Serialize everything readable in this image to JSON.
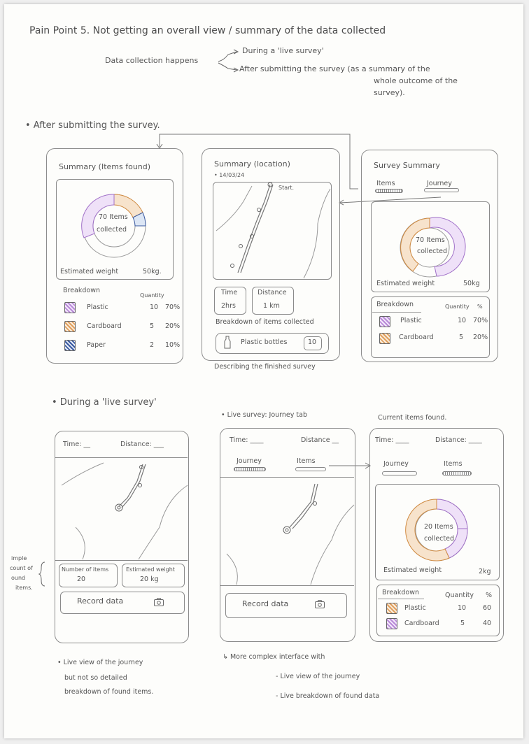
{
  "title": "Pain Point 5. Not getting an overall view / summary of the data collected",
  "intro": {
    "label": "Data collection happens",
    "branch1": "During a 'live survey'",
    "branch2_line1": "After submitting the survey (as a summary of the",
    "branch2_line2": "whole outcome of the",
    "branch2_line3": "survey)."
  },
  "section1": {
    "heading": "• After submitting the survey."
  },
  "screen1": {
    "title": "Summary (Items found)",
    "donut_line1": "70 Items",
    "donut_line2": "collected",
    "est_label": "Estimated weight",
    "est_value": "50kg.",
    "breakdown": "Breakdown",
    "quantity": "Quantity",
    "rows": [
      {
        "name": "Plastic",
        "qty": "10",
        "pct": "70%"
      },
      {
        "name": "Cardboard",
        "qty": "5",
        "pct": "20%"
      },
      {
        "name": "Paper",
        "qty": "2",
        "pct": "10%"
      }
    ]
  },
  "screen2": {
    "title": "Summary (location)",
    "date": "• 14/03/24",
    "start": "Start.",
    "time_label": "Time",
    "time_value": "2hrs",
    "dist_label": "Distance",
    "dist_value": "1 km",
    "breakdown": "Breakdown of items collected",
    "item_name": "Plastic bottles",
    "item_count": "10",
    "caption": "Describing the finished survey"
  },
  "screen3": {
    "title": "Survey Summary",
    "tab1": "Items",
    "tab2": "Journey",
    "donut_line1": "70 Items",
    "donut_line2": "collected",
    "est_label": "Estimated weight",
    "est_value": "50kg",
    "breakdown": "Breakdown",
    "quantity": "Quantity",
    "pct_head": "%",
    "rows": [
      {
        "name": "Plastic",
        "qty": "10",
        "pct": "70%"
      },
      {
        "name": "Cardboard",
        "qty": "5",
        "pct": "20%"
      }
    ]
  },
  "section2": {
    "heading": "• During a 'live survey'"
  },
  "screen4": {
    "time": "Time: __",
    "distance": "Distance: ___",
    "num_label": "Number of items",
    "num_value": "20",
    "est_label": "Estimated weight",
    "est_value": "20 kg",
    "record": "Record data",
    "side_note": [
      "imple",
      "count of",
      "ound",
      "items."
    ],
    "note_line1": "• Live view of the journey",
    "note_line2": "but not so detailed",
    "note_line3": "breakdown of found items."
  },
  "screen5": {
    "heading": "• Live survey: Journey tab",
    "time": "Time: ____",
    "distance": "Distance __",
    "tab1": "Journey",
    "tab2": "Items",
    "record": "Record data"
  },
  "screen6": {
    "heading": "Current items found.",
    "time": "Time: ____",
    "distance": "Distance: ____",
    "tab1": "Journey",
    "tab2": "Items",
    "donut_line1": "20 Items",
    "donut_line2": "collected",
    "est_label": "Estimated weight",
    "est_value": "2kg",
    "breakdown": "Breakdown",
    "quantity": "Quantity",
    "pct_head": "%",
    "rows": [
      {
        "name": "Plastic",
        "qty": "10",
        "pct": "60"
      },
      {
        "name": "Cardboard",
        "qty": "5",
        "pct": "40"
      }
    ]
  },
  "notes": {
    "line1": "↳ More complex interface with",
    "line2": "- Live view of the journey",
    "line3": "- Live breakdown of found data"
  }
}
